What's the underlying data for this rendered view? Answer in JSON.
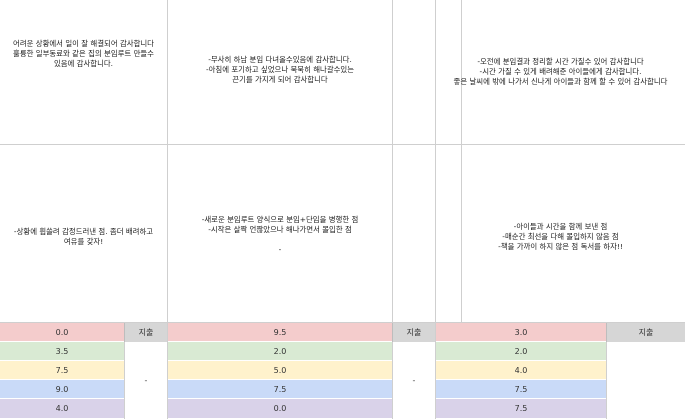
{
  "colors": {
    "row1": "#f4cccc",
    "row2": "#d9ead3",
    "row3": "#fff2cc",
    "row4": "#c9daf8",
    "row5": "#d9d2e9",
    "tag_bg": "#d6d6d6",
    "grid_line": "#cfcfcf"
  },
  "columns": [
    {
      "gratitude": "어려운 상황에서 일이 잘 해결되어 감사합니다\n훌륭한 일부동료와 같은 집의 분임루트 만들수\n있음에 감사합니다.",
      "reflection": "-상황에 휩쓸려 감정드러낸 점. 좀더 배려하고\n여유를 갖자!",
      "scores": [
        "0.0",
        "3.5",
        "7.5",
        "9.0",
        "4.0"
      ],
      "tag": "지출",
      "dash": "-"
    },
    {
      "gratitude": "-무사히 하남 분임 다녀올수있음에 감사합니다.\n-아침에 포기하고 싶었으나 묵묵히 해나갈수있는\n끈기를 가지게 되어 감사합니다",
      "reflection": "-새로운 분임루트 양식으로 분임+단임을 병행한 점\n-시작은 살짝 언짢았으나 해나가면서 몰입한 점\n\n-",
      "scores": [
        "9.5",
        "2.0",
        "5.0",
        "7.5",
        "0.0"
      ],
      "tag": "지출",
      "dash": "-"
    },
    {
      "gratitude": "-오전에 분임결과 정리할 시간 가질수 있어 감사합니다\n-시간 가질 수 있게 배려해준 아이들에게 감사합니다.\n좋은 날씨에 밖에 나가서 신나게 아이들과 함께 할 수 있어 감사합니다",
      "reflection": "-아이들과 시간을 함께 보낸 점\n-매순간 최선을 다해 몰입하지 않음 점\n-책을 가까이 하지 않은 점 독서를 하자!!",
      "scores": [
        "3.0",
        "2.0",
        "4.0",
        "7.5",
        "7.5"
      ],
      "tag": "지출",
      "dash": ""
    }
  ]
}
